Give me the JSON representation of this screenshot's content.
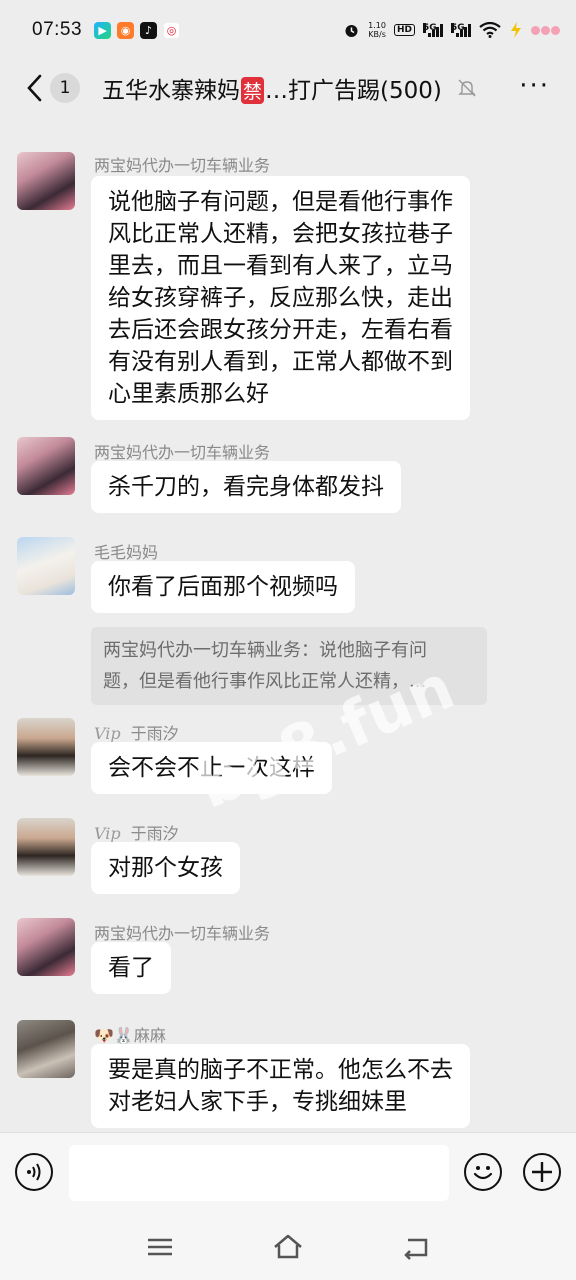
{
  "status_bar": {
    "time": "07:53",
    "net_speed_value": "1.10",
    "net_speed_unit": "KB/s",
    "hd_label": "HD",
    "signal1_label": "5G",
    "signal2_label": "5G"
  },
  "header": {
    "back_icon": "chevron-left-icon",
    "unread_count": "1",
    "title_prefix": "五华水寨辣妈",
    "title_mark": "禁",
    "title_suffix": "…打广告踢(500)",
    "more_label": "···"
  },
  "messages": [
    {
      "sender": "两宝妈代办一切车辆业务",
      "vip": false,
      "lines": [
        "说他脑子有问题，但是看他行事作",
        "风比正常人还精，会把女孩拉巷子",
        "里去，而且一看到有人来了，立马",
        "给女孩穿裤子，反应那么快，走出",
        "去后还会跟女孩分开走，左看右看",
        "有没有别人看到，正常人都做不到",
        "心里素质那么好"
      ]
    },
    {
      "sender": "两宝妈代办一切车辆业务",
      "vip": false,
      "lines": [
        "杀千刀的，看完身体都发抖"
      ]
    },
    {
      "sender": "毛毛妈妈",
      "vip": false,
      "lines": [
        "你看了后面那个视频吗"
      ],
      "quote_lines": [
        "两宝妈代办一切车辆业务：说他脑子有问",
        "题，但是看他行事作风比正常人还精，..."
      ]
    },
    {
      "sender": "于雨汐",
      "vip": true,
      "vip_label": "Vip",
      "lines": [
        "会不会不止一次这样"
      ]
    },
    {
      "sender": "于雨汐",
      "vip": true,
      "vip_label": "Vip",
      "lines": [
        "对那个女孩"
      ]
    },
    {
      "sender": "两宝妈代办一切车辆业务",
      "vip": false,
      "lines": [
        "看了"
      ]
    },
    {
      "sender": "🐶🐰麻麻",
      "vip": false,
      "lines": [
        "要是真的脑子不正常。他怎么不去",
        "对老妇人家下手，专挑细妹里"
      ]
    }
  ],
  "watermark": "bg8.fun",
  "input_bar": {
    "voice_icon": "voice-icon",
    "emoji_icon": "emoji-icon",
    "plus_icon": "plus-icon",
    "text_value": ""
  },
  "nav_bar": {
    "menu_icon": "menu-icon",
    "home_icon": "home-icon",
    "back_icon": "back-icon"
  },
  "colors": {
    "background": "#ededed",
    "bubble": "#ffffff",
    "quote": "#e1e1e1",
    "sender": "#8a8a8a",
    "ban_mark": "#e0303a"
  }
}
